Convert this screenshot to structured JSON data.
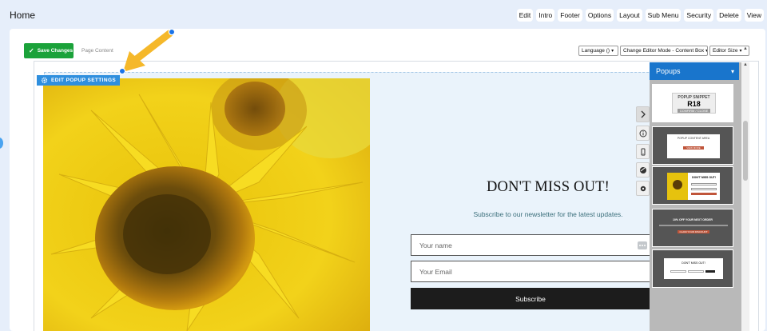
{
  "page": {
    "title": "Home"
  },
  "top_menu": [
    "Edit",
    "Intro",
    "Footer",
    "Options",
    "Layout",
    "Sub Menu",
    "Security",
    "Delete",
    "View"
  ],
  "toolbar": {
    "save_label": "Save Changes",
    "breadcrumb": "Page Content",
    "language_select": "Language ()",
    "mode_select": "Change Editor Mode - Content Box",
    "size_select": "Editor Size"
  },
  "editor": {
    "popup_settings_label": "EDIT POPUP SETTINGS"
  },
  "popup": {
    "headline": "DON'T MISS OUT!",
    "subline": "Subscribe to our newsletter for the latest updates.",
    "name_placeholder": "Your name",
    "email_placeholder": "Your Email",
    "subscribe_label": "Subscribe"
  },
  "popups_panel": {
    "title": "Popups",
    "thumbs": [
      {
        "line1": "POPUP SNIPPET",
        "line2": "R18",
        "line3": "CONFIRM / CLOSE"
      },
      {
        "line1": "POPUP CONTENT AREA",
        "button": "VIEW MORE"
      },
      {
        "line1": "DON'T MISS OUT!"
      },
      {
        "line1": "10% OFF YOUR NEXT ORDER",
        "button": "CLAIM YOUR DISCOUNT"
      },
      {
        "line1": "DON'T MISS OUT!"
      }
    ]
  },
  "colors": {
    "accent_blue": "#1975cc",
    "save_green": "#1ba23a",
    "arrow_yellow": "#f5b82a",
    "subscribe_dark": "#1c1c1c"
  }
}
